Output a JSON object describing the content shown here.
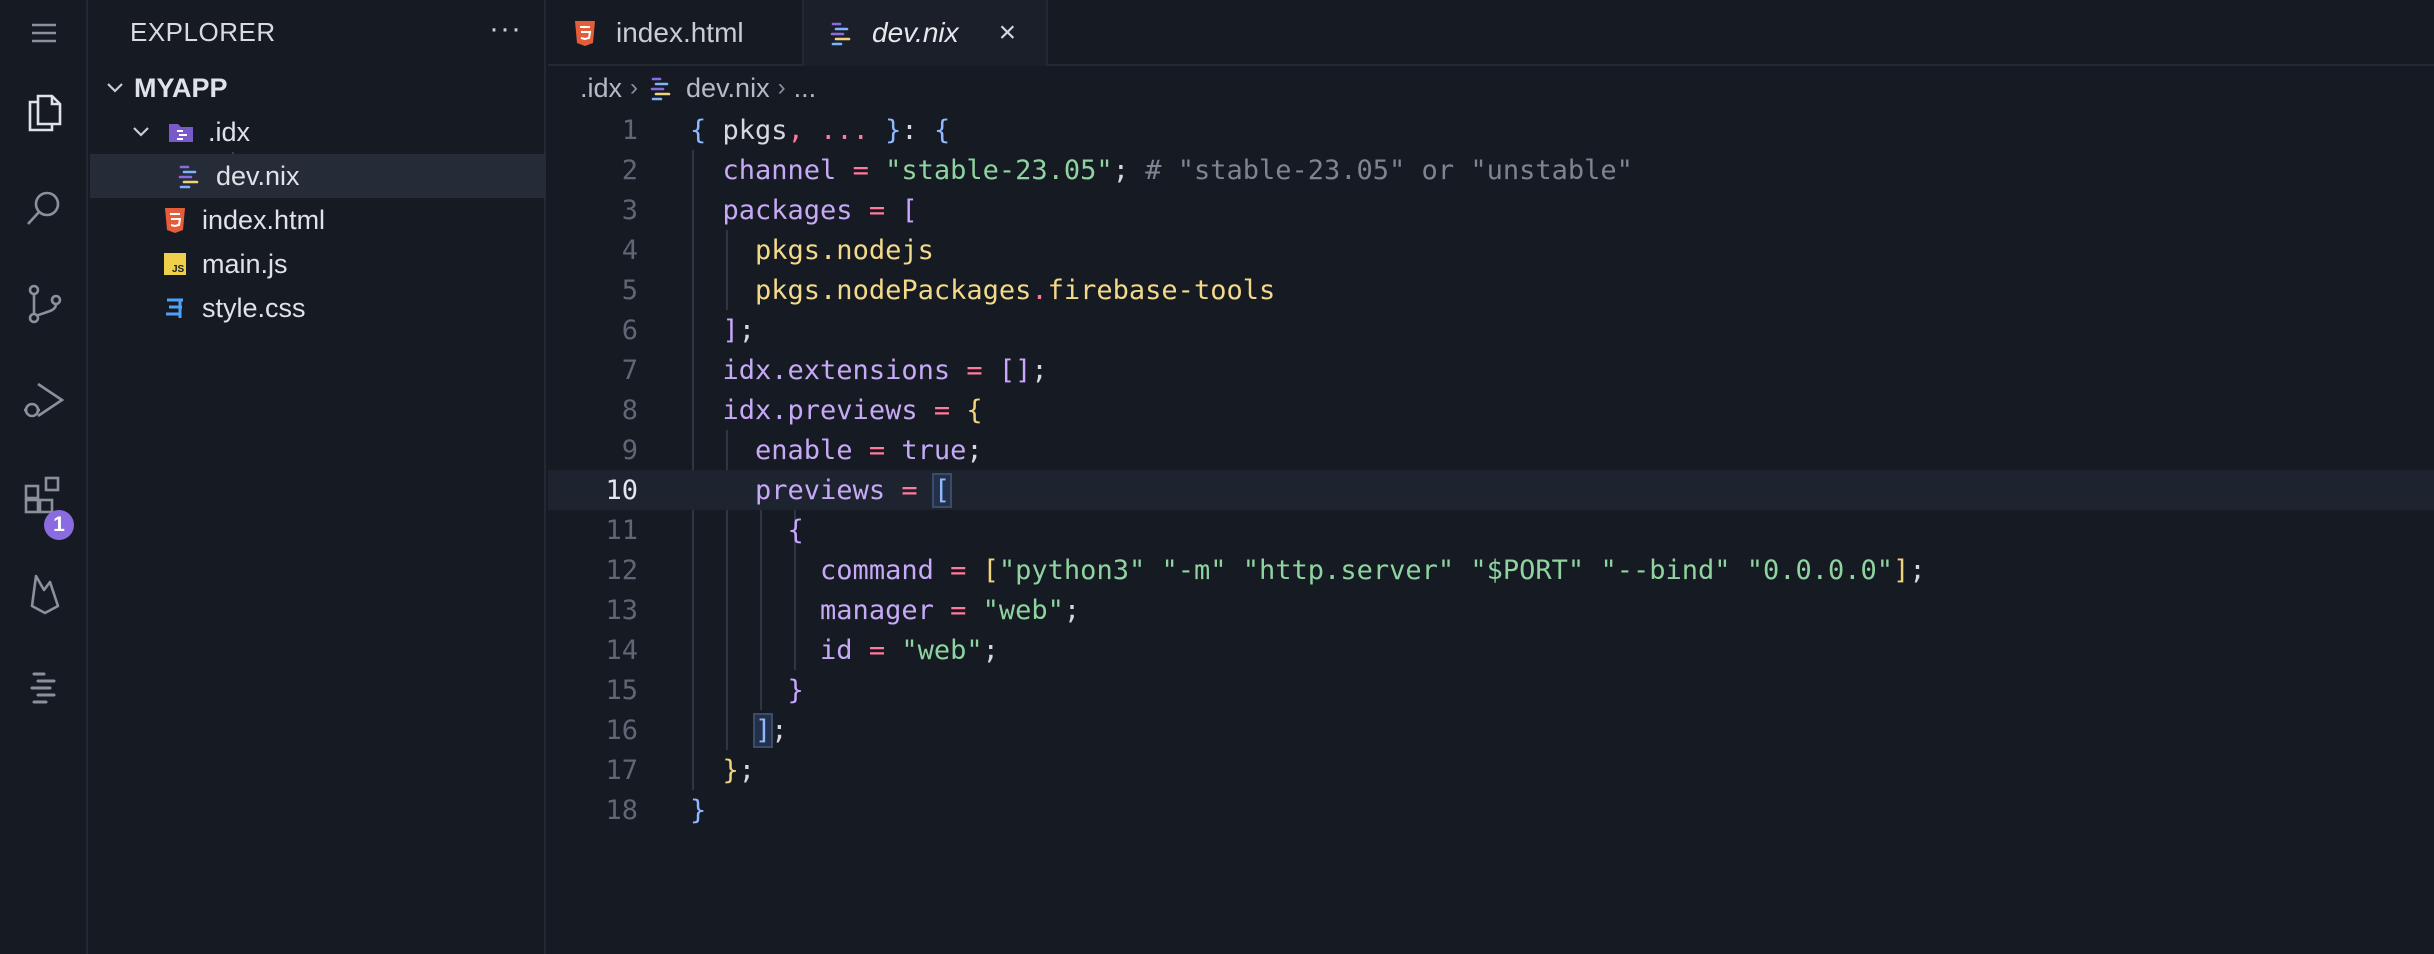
{
  "explorer": {
    "title": "EXPLORER",
    "more_label": "···",
    "project": "MYAPP",
    "folder": ".idx",
    "files": {
      "devnix": "dev.nix",
      "index": "index.html",
      "main": "main.js",
      "style": "style.css"
    }
  },
  "activity": {
    "badge_count": "1"
  },
  "tabs": [
    {
      "label": "index.html",
      "icon": "html5-icon"
    },
    {
      "label": "dev.nix",
      "icon": "nix-icon",
      "active": true
    }
  ],
  "tab_close": "×",
  "breadcrumb": {
    "folder": ".idx",
    "file": "dev.nix",
    "ellipsis": "..."
  },
  "editor": {
    "current_line": 10,
    "line_numbers": [
      "1",
      "2",
      "3",
      "4",
      "5",
      "6",
      "7",
      "8",
      "9",
      "10",
      "11",
      "12",
      "13",
      "14",
      "15",
      "16",
      "17",
      "18"
    ]
  },
  "colors": {
    "background": "#161a22",
    "accent": "#8b6be0",
    "string": "#8fd4a0",
    "keyword": "#c7aaf7",
    "operator": "#ff7b9c"
  }
}
